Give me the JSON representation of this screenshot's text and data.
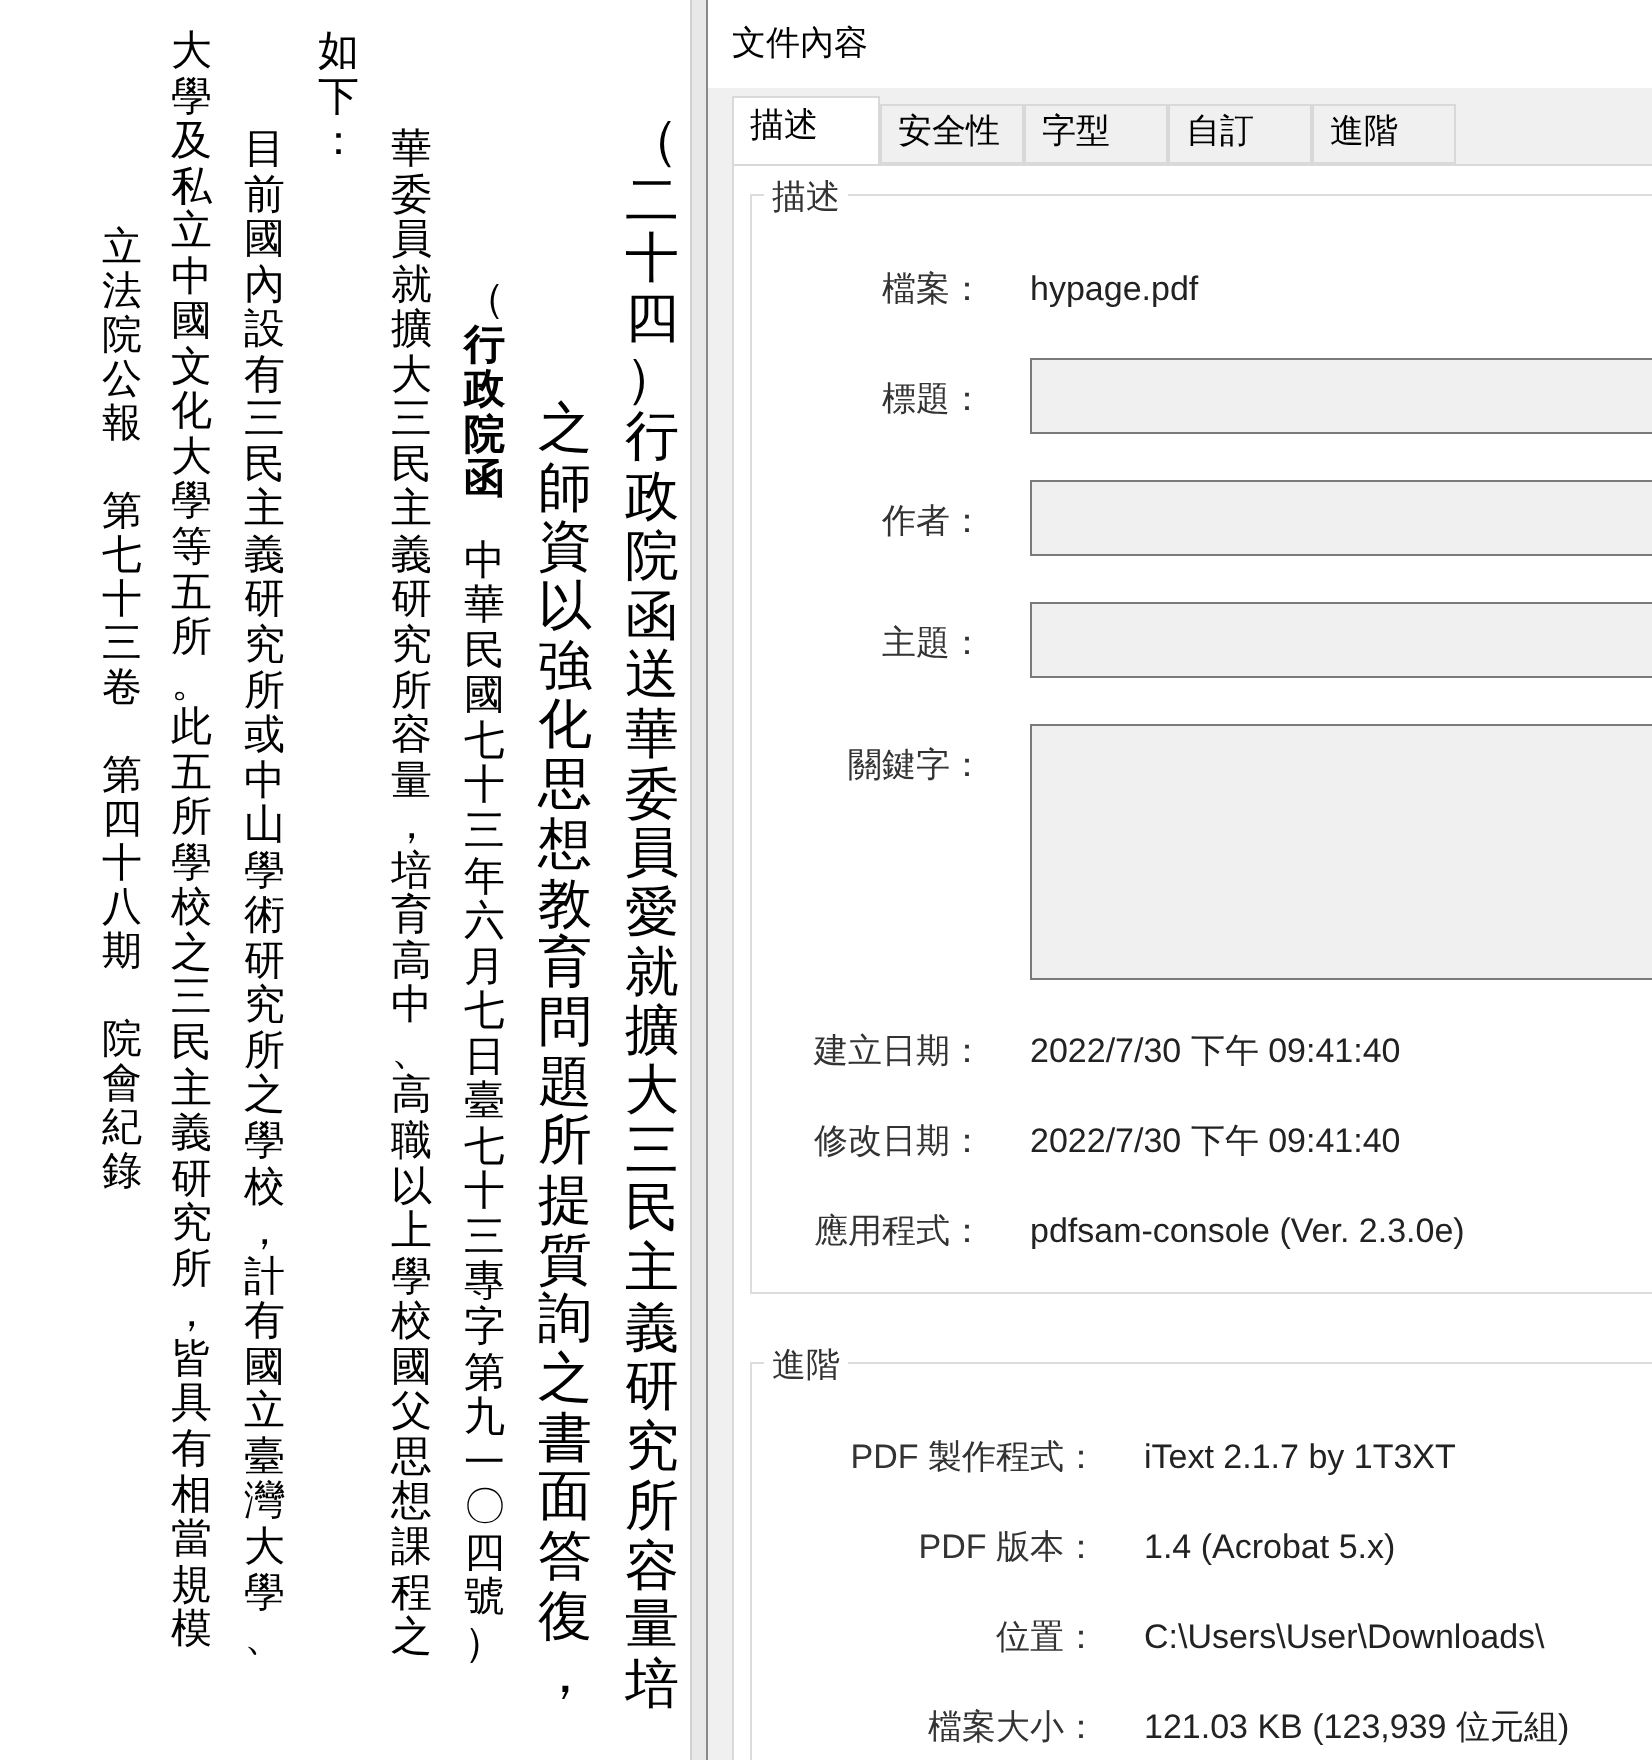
{
  "document": {
    "heading": {
      "text": "（二十四）行政院函送華委員愛就擴大三民主義研究所容量培",
      "continuation": "之師資以強化思想教育問題所提質詢之書面答復，"
    },
    "reference": {
      "source": "（**行政院函**",
      "text": "中華民國七十三年六月七日臺七十三專字第九一〇四號）"
    },
    "opening": {
      "text": "華委員就擴大三民主義研究所容量，培育高中、高職以上學校國父思想課程之",
      "continuation": "如下："
    },
    "body": {
      "text": "目前國內設有三民主義研究所或中山學術研究所之學校，計有國立臺灣大學、",
      "continuation": "大學及私立中國文化大學等五所。此五所學校之三民主義研究所，皆具有相當規模"
    },
    "footer": [
      "立法院公報",
      "第七十三卷",
      "第四十八期",
      "院會紀錄"
    ]
  },
  "dialog": {
    "title": "文件內容",
    "tabs": [
      {
        "label": "描述",
        "selected": true
      },
      {
        "label": "安全性",
        "selected": false
      },
      {
        "label": "字型",
        "selected": false
      },
      {
        "label": "自訂",
        "selected": false
      },
      {
        "label": "進階",
        "selected": false
      }
    ],
    "description": {
      "title": "描述",
      "rows": [
        {
          "kind": "text",
          "label": "檔案：",
          "value": "hypage.pdf"
        },
        {
          "kind": "field",
          "label": "標題：",
          "disabled": true
        },
        {
          "kind": "field",
          "label": "作者：",
          "disabled": true
        },
        {
          "kind": "field",
          "label": "主題：",
          "disabled": true
        },
        {
          "kind": "textarea",
          "label": "關鍵字：",
          "disabled": true
        },
        {
          "kind": "text",
          "label": "建立日期：",
          "value": "2022/7/30 下午 09:41:40"
        },
        {
          "kind": "text",
          "label": "修改日期：",
          "value": "2022/7/30 下午 09:41:40"
        },
        {
          "kind": "text",
          "label": "應用程式：",
          "value": "pdfsam-console (Ver. 2.3.0e)"
        }
      ]
    },
    "advanced": {
      "title": "進階",
      "rows": [
        {
          "label": "PDF 製作程式：",
          "value": "iText 2.1.7 by 1T3XT"
        },
        {
          "label": "PDF 版本：",
          "value": "1.4 (Acrobat 5.x)"
        },
        {
          "label": "位置：",
          "value": "C:\\Users\\User\\Downloads\\"
        },
        {
          "label": "檔案大小：",
          "value": "121.03 KB (123,939 位元組)"
        }
      ]
    }
  }
}
